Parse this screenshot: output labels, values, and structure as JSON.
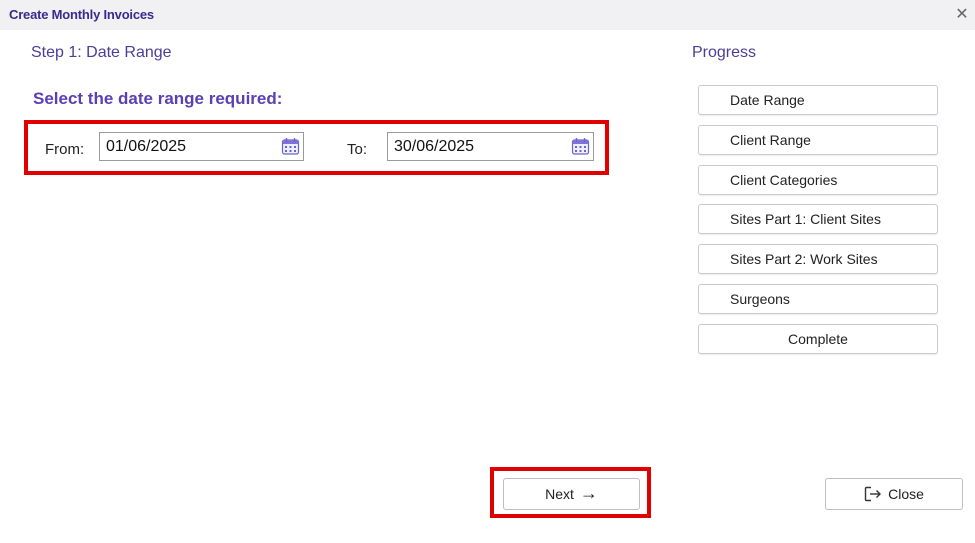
{
  "window": {
    "title": "Create Monthly Invoices",
    "close_icon": "close-icon"
  },
  "step": {
    "title": "Step 1: Date Range",
    "prompt": "Select the date range required:"
  },
  "dates": {
    "from_label": "From:",
    "from_value": "01/06/2025",
    "to_label": "To:",
    "to_value": "30/06/2025"
  },
  "progress": {
    "title": "Progress",
    "items": [
      {
        "label": "Date Range"
      },
      {
        "label": "Client Range"
      },
      {
        "label": "Client Categories"
      },
      {
        "label": "Sites Part 1: Client Sites"
      },
      {
        "label": "Sites Part 2: Work Sites"
      },
      {
        "label": "Surgeons"
      },
      {
        "label": "Complete"
      }
    ]
  },
  "actions": {
    "next_label": "Next",
    "close_label": "Close"
  },
  "colors": {
    "accent": "#5a3fb5",
    "title": "#3a2a8c",
    "highlight": "#e00000"
  }
}
